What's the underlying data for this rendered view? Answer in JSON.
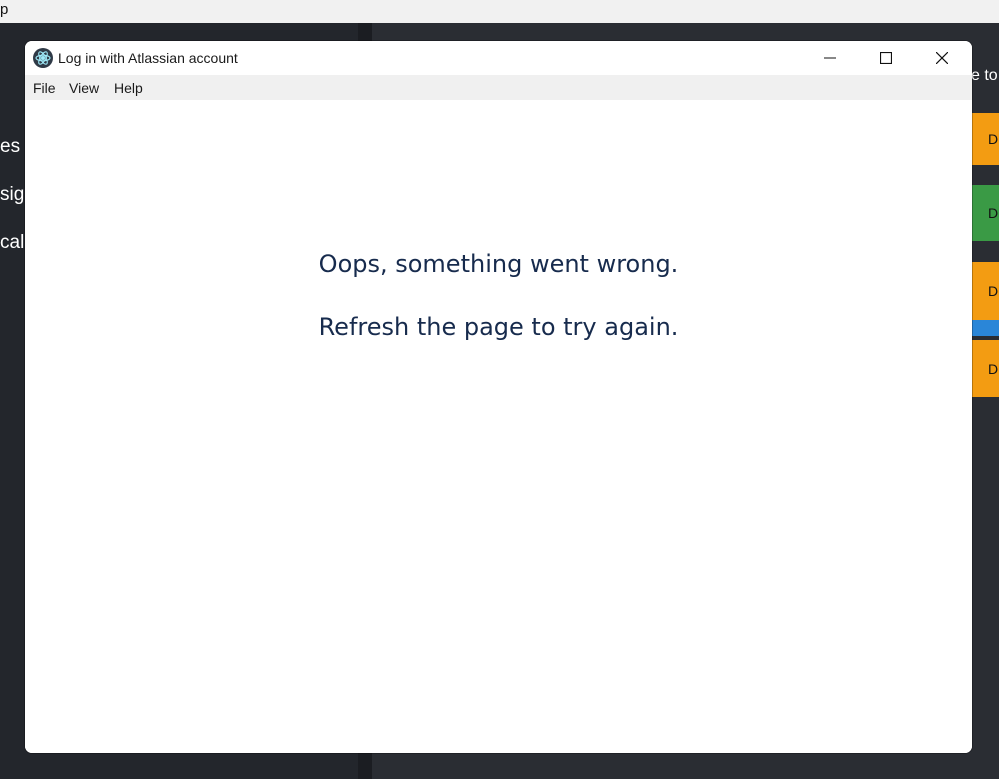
{
  "background": {
    "top_bar_text": "p",
    "sidebar_items": [
      "es",
      "sig",
      "cal"
    ],
    "right_header_text": "e to",
    "cards": [
      {
        "label": "D",
        "color": "#f39c12"
      },
      {
        "label": "D",
        "color": "#3a9a45"
      },
      {
        "label": "D",
        "color": "#f39c12"
      },
      {
        "label": "D",
        "color": "#f39c12"
      }
    ]
  },
  "window": {
    "title": "Log in with Atlassian account",
    "icon": "electron-app-icon",
    "controls": {
      "minimize": "minimize-icon",
      "maximize": "maximize-icon",
      "close": "close-icon"
    },
    "menu": [
      "File",
      "View",
      "Help"
    ]
  },
  "error": {
    "line1": "Oops, something went wrong.",
    "line2": "Refresh the page to try again.",
    "text_color": "#172b4d"
  }
}
